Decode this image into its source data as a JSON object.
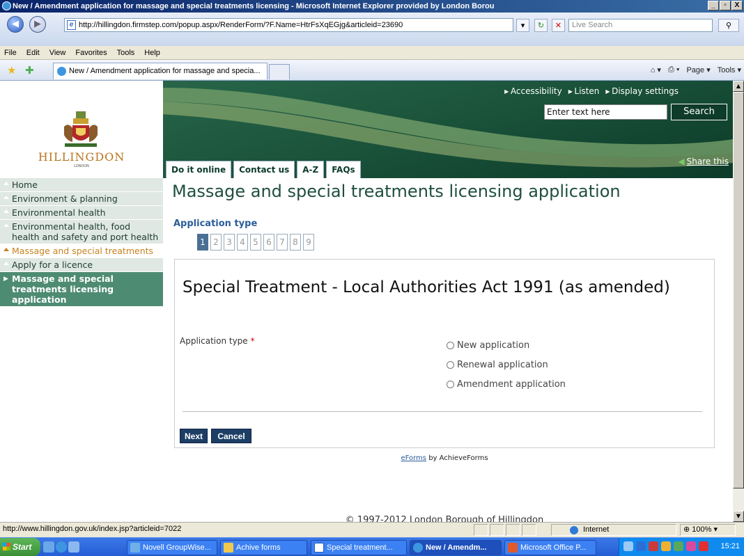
{
  "window": {
    "title": "New / Amendment application for massage and special treatments licensing - Microsoft Internet Explorer provided by London Borou",
    "controls": [
      "_",
      "▫",
      "X"
    ]
  },
  "browser": {
    "address": "http://hillingdon.firmstep.com/popup.aspx/RenderForm/?F.Name=HtrFsXqEGjg&articleid=23690",
    "live_search_placeholder": "Live Search",
    "menu": [
      "File",
      "Edit",
      "View",
      "Favorites",
      "Tools",
      "Help"
    ],
    "tab_title": "New / Amendment application for massage and specia...",
    "command_bar": [
      "Page ▾",
      "Tools ▾"
    ],
    "status_url": "http://www.hillingdon.gov.uk/index.jsp?articleid=7022",
    "zone": "Internet",
    "zoom": "100%"
  },
  "site": {
    "logo_text": "HILLINGDON",
    "logo_sub": "LONDON",
    "top_links": [
      "Accessibility",
      "Listen",
      "Display settings"
    ],
    "search_placeholder": "Enter text here",
    "search_button": "Search",
    "share": "Share this",
    "nav_tabs": [
      "Do it online",
      "Contact us",
      "A-Z",
      "FAQs"
    ]
  },
  "sidebar": {
    "items": [
      {
        "label": "Home"
      },
      {
        "label": "Environment & planning"
      },
      {
        "label": "Environmental health"
      },
      {
        "label": "Environmental health, food health and safety and port health"
      },
      {
        "label": "Massage and special treatments"
      },
      {
        "label": "Apply for a licence"
      },
      {
        "label": "Massage and special treatments licensing application"
      }
    ]
  },
  "main": {
    "page_title": "Massage and special treatments licensing application",
    "section_label": "Application type",
    "steps": [
      "1",
      "2",
      "3",
      "4",
      "5",
      "6",
      "7",
      "8",
      "9"
    ],
    "current_step": "1",
    "form_heading": "Special Treatment - Local Authorities Act 1991 (as amended)",
    "field_label": "Application type",
    "required_mark": "*",
    "options": [
      "New application",
      "Renewal application",
      "Amendment application"
    ],
    "next_button": "Next",
    "cancel_button": "Cancel",
    "eforms_link": "eForms",
    "eforms_suffix": "by AchieveForms",
    "copyright": "© 1997-2012 London Borough of Hillingdon"
  },
  "taskbar": {
    "start": "Start",
    "tasks": [
      "Novell GroupWise...",
      "Achive forms",
      "Special treatment...",
      "New / Amendm...",
      "Microsoft Office P..."
    ],
    "clock": "15:21"
  }
}
